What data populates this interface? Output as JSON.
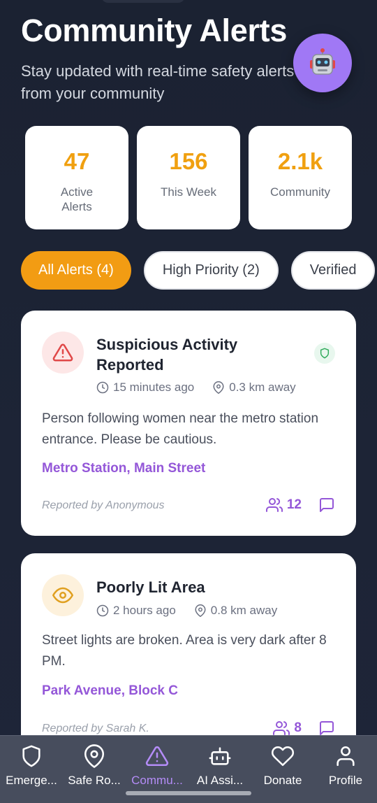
{
  "header": {
    "title": "Community Alerts",
    "subtitle": "Stay updated with real-time safety alerts from your community"
  },
  "assistant_fab": {
    "icon": "robot-icon"
  },
  "stats": [
    {
      "value": "47",
      "label": "Active Alerts"
    },
    {
      "value": "156",
      "label": "This Week"
    },
    {
      "value": "2.1k",
      "label": "Community"
    }
  ],
  "filters": [
    {
      "label": "All Alerts (4)",
      "active": true
    },
    {
      "label": "High Priority (2)",
      "active": false
    },
    {
      "label": "Verified",
      "active": false
    }
  ],
  "alerts": [
    {
      "icon": "warning-triangle-icon",
      "title": "Suspicious Activity Reported",
      "verified": true,
      "time": "15 minutes ago",
      "distance": "0.3 km away",
      "description": "Person following women near the metro station entrance. Please be cautious.",
      "location": "Metro Station, Main Street",
      "reporter": "Reported by Anonymous",
      "supporters": "12"
    },
    {
      "icon": "eye-icon",
      "title": "Poorly Lit Area",
      "verified": false,
      "time": "2 hours ago",
      "distance": "0.8 km away",
      "description": "Street lights are broken. Area is very dark after 8 PM.",
      "location": "Park Avenue, Block C",
      "reporter": "Reported by Sarah K.",
      "supporters": "8"
    }
  ],
  "nav": [
    {
      "label": "Emerge...",
      "icon": "shield-icon",
      "active": false
    },
    {
      "label": "Safe Ro...",
      "icon": "map-pin-icon",
      "active": false
    },
    {
      "label": "Commu...",
      "icon": "alert-triangle-icon",
      "active": true
    },
    {
      "label": "AI Assi...",
      "icon": "bot-icon",
      "active": false
    },
    {
      "label": "Donate",
      "icon": "heart-icon",
      "active": false
    },
    {
      "label": "Profile",
      "icon": "user-icon",
      "active": false
    }
  ],
  "colors": {
    "background": "#1b2232",
    "accent_orange": "#f29c13",
    "accent_purple": "#9457d8",
    "nav_active": "#b48cf7",
    "danger": "#e04848",
    "caution": "#e0a020",
    "verified_green": "#2eaa5a"
  }
}
